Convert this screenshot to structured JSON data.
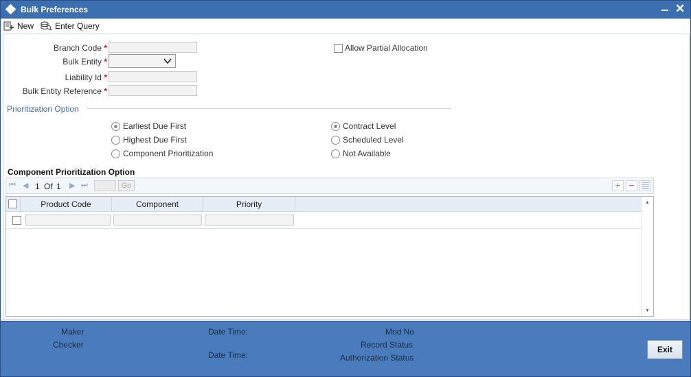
{
  "window": {
    "title": "Bulk Preferences"
  },
  "toolbar": {
    "new_label": "New",
    "enter_query_label": "Enter Query"
  },
  "form": {
    "branch_code": {
      "label": "Branch Code",
      "required": "*",
      "value": ""
    },
    "bulk_entity": {
      "label": "Bulk Entity",
      "required": "*",
      "value": ""
    },
    "liability_id": {
      "label": "Liability Id",
      "required": "*",
      "value": ""
    },
    "bulk_entity_reference": {
      "label": "Bulk Entity Reference",
      "required": "*",
      "value": ""
    },
    "allow_partial_allocation": {
      "label": "Allow Partial Allocation",
      "checked": false
    }
  },
  "prioritization": {
    "title": "Prioritization Option",
    "group1": [
      {
        "label": "Earliest Due First",
        "selected": true
      },
      {
        "label": "Highest Due First",
        "selected": false
      },
      {
        "label": "Component Prioritization",
        "selected": false
      }
    ],
    "group2": [
      {
        "label": "Contract Level",
        "selected": true
      },
      {
        "label": "Scheduled Level",
        "selected": false
      },
      {
        "label": "Not Available",
        "selected": false
      }
    ]
  },
  "component_grid": {
    "title": "Component Prioritization Option",
    "pager": {
      "current": "1",
      "of_label": "Of",
      "total": "1",
      "go_label": "Go"
    },
    "columns": [
      "Product Code",
      "Component",
      "Priority"
    ],
    "rows": [
      {
        "product_code": "",
        "component": "",
        "priority": ""
      }
    ]
  },
  "footer": {
    "maker_label": "Maker",
    "checker_label": "Checker",
    "date_time_label_1": "Date Time:",
    "date_time_label_2": "Date Time:",
    "mod_no_label": "Mod No",
    "record_status_label": "Record Status",
    "authorization_status_label": "Authorization Status",
    "exit_label": "Exit"
  },
  "colors": {
    "titlebar": "#3b6fb0",
    "footer": "#4a7cbd",
    "section": "#466aa3",
    "required": "#c0161b"
  }
}
